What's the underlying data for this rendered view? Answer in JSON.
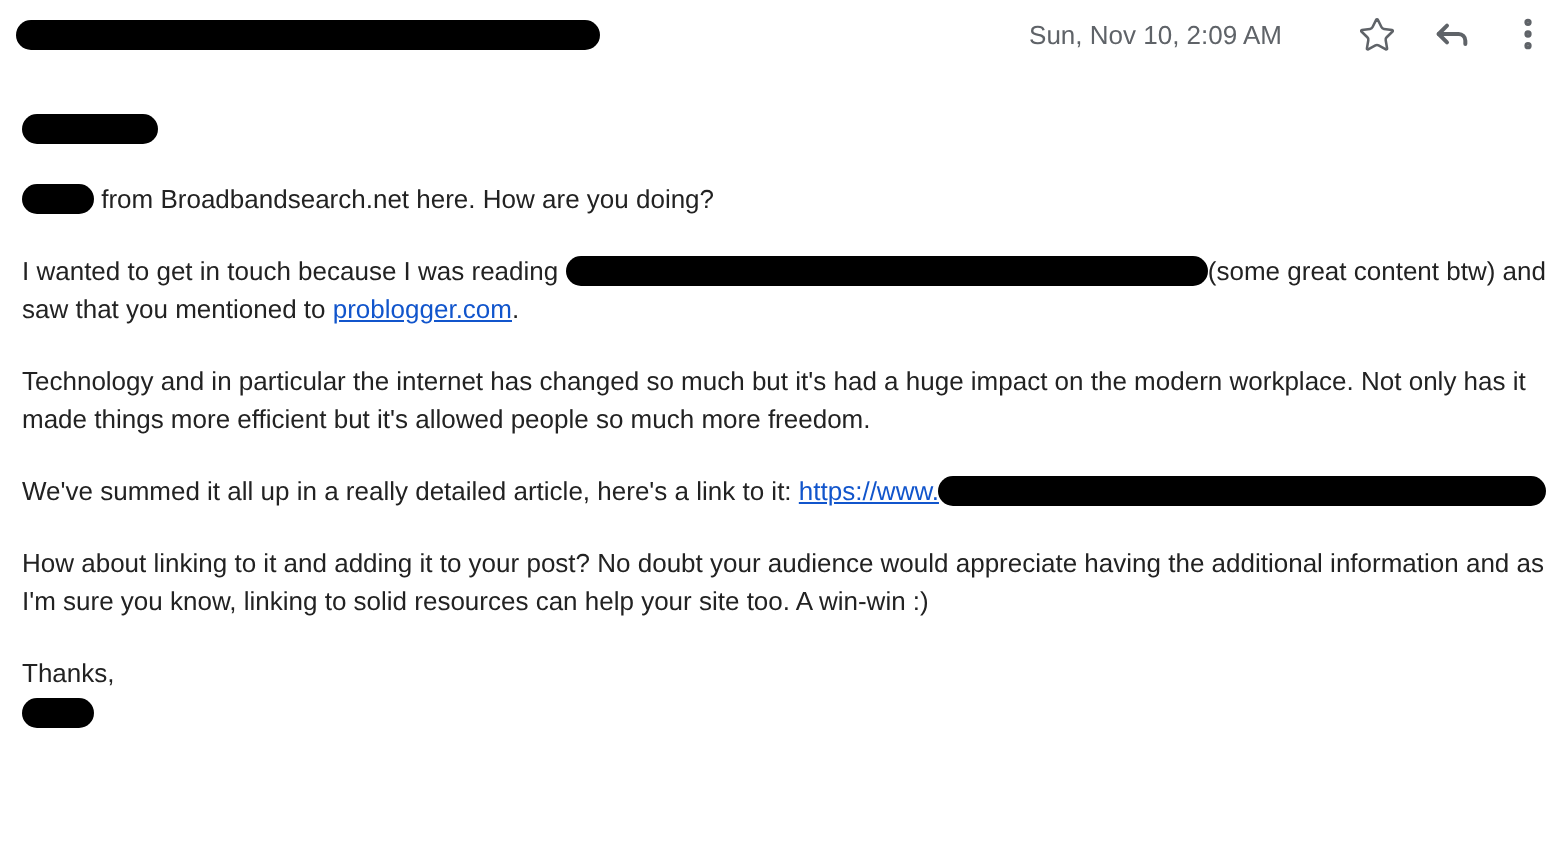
{
  "header": {
    "sender": [
      {
        "kind": "redaction"
      }
    ],
    "date": "Sun, Nov 10, 2:09 AM",
    "starred": false
  },
  "greeting": [
    {
      "kind": "redaction"
    }
  ],
  "paragraphs": [
    [
      [
        {
          "kind": "redaction"
        },
        {
          "kind": "text",
          "text": " from Broadbandsearch.net here. How are you doing?"
        }
      ]
    ],
    [
      [
        {
          "kind": "text",
          "text": "I wanted to get in touch because I was reading "
        },
        {
          "kind": "redaction"
        },
        {
          "kind": "text",
          "text": "(some great content btw) and"
        }
      ],
      [
        {
          "kind": "text",
          "text": "saw that you mentioned to "
        },
        {
          "kind": "link",
          "text": "problogger.com"
        },
        {
          "kind": "text",
          "text": "."
        }
      ]
    ],
    [
      [
        {
          "kind": "text",
          "text": "Technology and in particular the internet has changed so much but it's had a huge impact on the modern workplace. Not only has it made things more efficient but it's allowed people so much more freedom."
        }
      ]
    ],
    [
      [
        {
          "kind": "text",
          "text": "We've summed it all up in a really detailed article, here's a link to it: "
        },
        {
          "kind": "link",
          "text": "https://www."
        },
        {
          "kind": "redaction"
        }
      ]
    ],
    [
      [
        {
          "kind": "text",
          "text": "How about linking to it and adding it to your post? No doubt your audience would appreciate having the additional information and as I'm sure you know, linking to solid resources can help your site too. A win-win :)"
        }
      ]
    ]
  ],
  "signoff": "Thanks,",
  "signature": [
    {
      "kind": "redaction"
    }
  ]
}
